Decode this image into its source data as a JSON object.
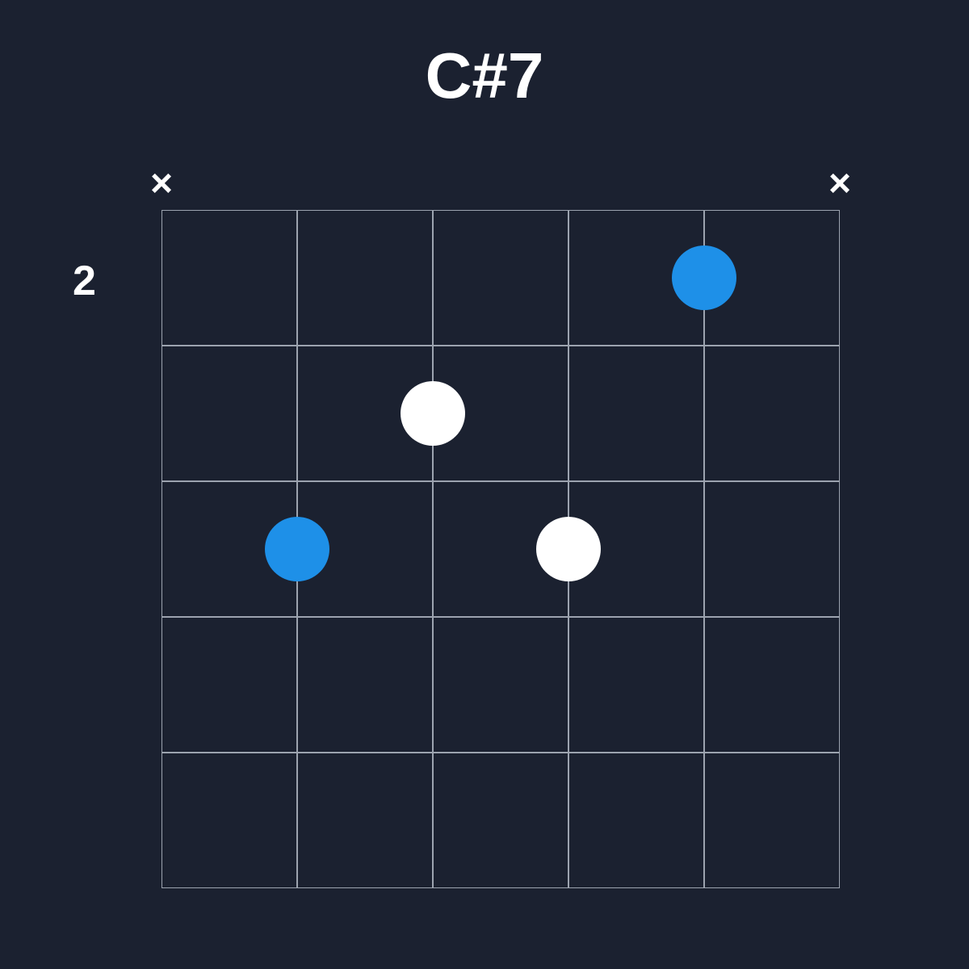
{
  "chord": {
    "name": "C#7",
    "starting_fret": "2",
    "num_frets": 5,
    "num_strings": 6,
    "string_markers": [
      {
        "string": 1,
        "symbol": "×"
      },
      {
        "string": 6,
        "symbol": "×"
      }
    ],
    "dots": [
      {
        "string": 5,
        "fret": 1,
        "is_root": true
      },
      {
        "string": 3,
        "fret": 2,
        "is_root": false
      },
      {
        "string": 2,
        "fret": 3,
        "is_root": true
      },
      {
        "string": 4,
        "fret": 3,
        "is_root": false
      }
    ],
    "colors": {
      "background": "#1b2130",
      "grid": "#9ca3af",
      "text": "#ffffff",
      "root_dot": "#1e90e8",
      "normal_dot": "#ffffff"
    }
  }
}
